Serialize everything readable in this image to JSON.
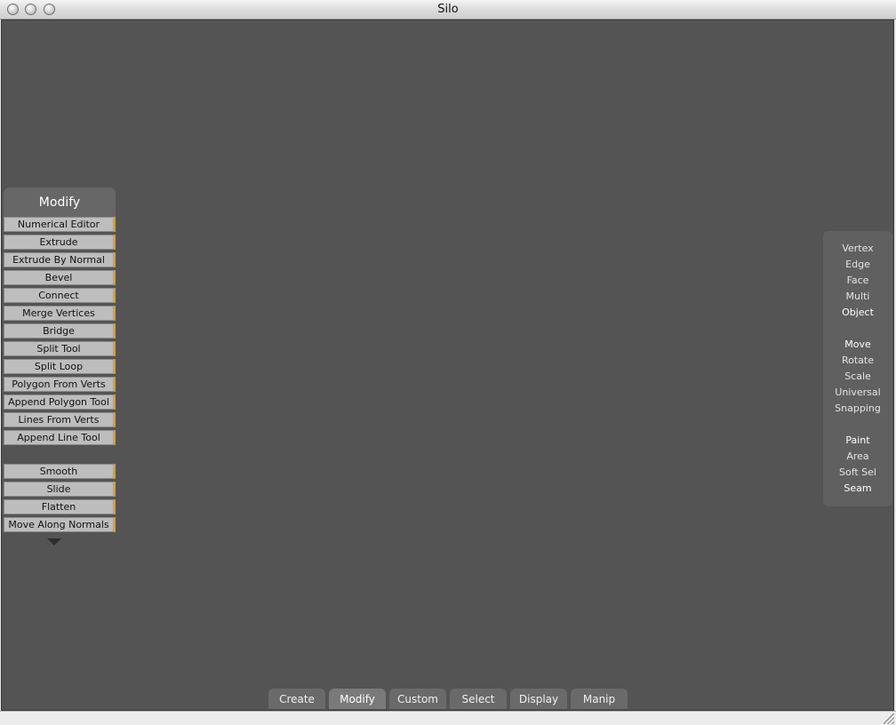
{
  "window": {
    "title": "Silo"
  },
  "modify_panel": {
    "title": "Modify",
    "group1": [
      "Numerical Editor",
      "Extrude",
      "Extrude By Normal",
      "Bevel",
      "Connect",
      "Merge Vertices",
      "Bridge",
      "Split Tool",
      "Split Loop",
      "Polygon From Verts",
      "Append Polygon Tool",
      "Lines From Verts",
      "Append Line Tool"
    ],
    "group2": [
      "Smooth",
      "Slide",
      "Flatten",
      "Move Along Normals"
    ],
    "more_icon": "triangle-down-icon"
  },
  "right_panel": {
    "selection_modes": [
      "Vertex",
      "Edge",
      "Face",
      "Multi",
      "Object"
    ],
    "active_selection_mode": "Object",
    "manipulators": [
      "Move",
      "Rotate",
      "Scale",
      "Universal",
      "Snapping"
    ],
    "active_manipulator": "Move",
    "select_tools": [
      "Paint",
      "Area",
      "Soft Sel",
      "Seam"
    ],
    "active_select_tools": [
      "Paint",
      "Seam"
    ]
  },
  "tabs": [
    "Create",
    "Modify",
    "Custom",
    "Select",
    "Display",
    "Manip"
  ],
  "active_tab": "Modify",
  "colors": {
    "viewport": "#545454",
    "button_accent": "#c9a24a"
  }
}
